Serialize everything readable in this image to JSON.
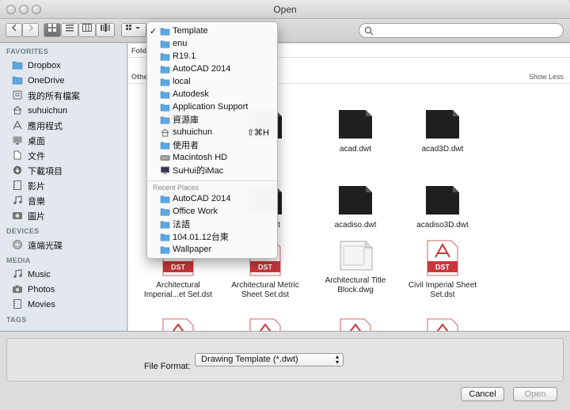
{
  "window": {
    "title": "Open"
  },
  "toolbar": {
    "back_icon": "chevron-left-icon",
    "forward_icon": "chevron-right-icon",
    "view_icons": [
      "icon-view-icon",
      "list-view-icon",
      "column-view-icon",
      "coverflow-view-icon"
    ],
    "arrange_icon": "arrange-icon",
    "search_placeholder": ""
  },
  "sidebar": {
    "favorites_label": "FAVORITES",
    "favorites": [
      {
        "label": "Dropbox",
        "icon": "folder-icon"
      },
      {
        "label": "OneDrive",
        "icon": "folder-icon"
      },
      {
        "label": "我的所有檔案",
        "icon": "all-files-icon"
      },
      {
        "label": "suhuichun",
        "icon": "home-icon"
      },
      {
        "label": "應用程式",
        "icon": "applications-icon"
      },
      {
        "label": "桌面",
        "icon": "desktop-icon"
      },
      {
        "label": "文件",
        "icon": "documents-icon"
      },
      {
        "label": "下載項目",
        "icon": "downloads-icon"
      },
      {
        "label": "影片",
        "icon": "movies-icon"
      },
      {
        "label": "音樂",
        "icon": "music-icon"
      },
      {
        "label": "圖片",
        "icon": "pictures-icon"
      }
    ],
    "devices_label": "DEVICES",
    "devices": [
      {
        "label": "遠端光碟",
        "icon": "remote-disc-icon"
      }
    ],
    "media_label": "MEDIA",
    "media": [
      {
        "label": "Music",
        "icon": "music-icon"
      },
      {
        "label": "Photos",
        "icon": "camera-icon"
      },
      {
        "label": "Movies",
        "icon": "movies-icon"
      }
    ],
    "tags_label": "TAGS"
  },
  "content": {
    "folders_section": "Fold",
    "other_section": "Othe",
    "show_less": "Show Less",
    "files": [
      {
        "name": "ac",
        "kind": "dark"
      },
      {
        "name": "Plot wt",
        "kind": "partial"
      },
      {
        "name": "acad.dwt",
        "kind": "dark"
      },
      {
        "name": "acad3D.dwt",
        "kind": "dark"
      },
      {
        "name": "ac I",
        "kind": "dark-hidden"
      },
      {
        "name": "ned .dwt",
        "kind": "partial"
      },
      {
        "name": "acadiso.dwt",
        "kind": "dark"
      },
      {
        "name": "acadiso3D.dwt",
        "kind": "dark"
      },
      {
        "name": "Architectural Imperial...et Set.dst",
        "kind": "dst"
      },
      {
        "name": "Architectural Metric Sheet Set.dst",
        "kind": "dst"
      },
      {
        "name": "Architectural Title Block.dwg",
        "kind": "dwg"
      },
      {
        "name": "Civil Imperial Sheet Set.dst",
        "kind": "dst"
      }
    ],
    "dst_badge": "DST"
  },
  "dropdown": {
    "current": "Template",
    "locations": [
      {
        "label": "Template",
        "icon": "folder-icon",
        "checked": true
      },
      {
        "label": "enu",
        "icon": "folder-icon"
      },
      {
        "label": "R19.1",
        "icon": "folder-icon"
      },
      {
        "label": "AutoCAD 2014",
        "icon": "folder-icon"
      },
      {
        "label": "local",
        "icon": "folder-icon"
      },
      {
        "label": "Autodesk",
        "icon": "folder-icon"
      },
      {
        "label": "Application Support",
        "icon": "folder-icon"
      },
      {
        "label": "資源庫",
        "icon": "folder-icon"
      },
      {
        "label": "suhuichun",
        "icon": "home-icon",
        "shortcut": "⇧⌘H"
      },
      {
        "label": "使用者",
        "icon": "folder-icon"
      },
      {
        "label": "Macintosh HD",
        "icon": "hard-drive-icon"
      },
      {
        "label": "SuHui的iMac",
        "icon": "computer-icon"
      }
    ],
    "recent_label": "Recent Places",
    "recent": [
      {
        "label": "AutoCAD 2014",
        "icon": "folder-icon"
      },
      {
        "label": "Office Work",
        "icon": "folder-icon"
      },
      {
        "label": "法語",
        "icon": "folder-icon"
      },
      {
        "label": "104.01.12台東",
        "icon": "folder-icon"
      },
      {
        "label": "Wallpaper",
        "icon": "folder-icon"
      }
    ]
  },
  "footer": {
    "file_format_label": "File Format:",
    "file_format_value": "Drawing Template (*.dwt)",
    "cancel_label": "Cancel",
    "open_label": "Open"
  },
  "colors": {
    "folder": "#5aa7e2",
    "dst_red": "#c9373b",
    "sidebar_bg": "#e3e8ee"
  }
}
